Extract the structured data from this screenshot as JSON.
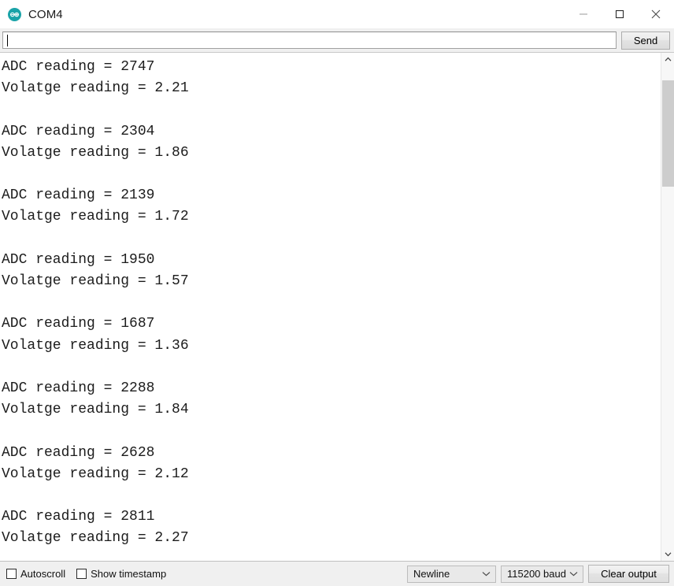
{
  "window": {
    "title": "COM4",
    "app_icon": "arduino-logo-icon",
    "accent_color": "#1aa3a8",
    "controls": {
      "minimize": "minimize-icon",
      "maximize": "maximize-icon",
      "close": "close-icon"
    }
  },
  "send_row": {
    "input_value": "",
    "input_placeholder": "",
    "send_label": "Send"
  },
  "output": {
    "text": "ADC reading = 2747\nVolatge reading = 2.21\n\nADC reading = 2304\nVolatge reading = 1.86\n\nADC reading = 2139\nVolatge reading = 1.72\n\nADC reading = 1950\nVolatge reading = 1.57\n\nADC reading = 1687\nVolatge reading = 1.36\n\nADC reading = 2288\nVolatge reading = 1.84\n\nADC reading = 2628\nVolatge reading = 2.12\n\nADC reading = 2811\nVolatge reading = 2.27",
    "readings": [
      {
        "adc_label": "ADC reading = 2747",
        "voltage_label": "Volatge reading = 2.21",
        "adc": 2747,
        "voltage": 2.21
      },
      {
        "adc_label": "ADC reading = 2304",
        "voltage_label": "Volatge reading = 1.86",
        "adc": 2304,
        "voltage": 1.86
      },
      {
        "adc_label": "ADC reading = 2139",
        "voltage_label": "Volatge reading = 1.72",
        "adc": 2139,
        "voltage": 1.72
      },
      {
        "adc_label": "ADC reading = 1950",
        "voltage_label": "Volatge reading = 1.57",
        "adc": 1950,
        "voltage": 1.57
      },
      {
        "adc_label": "ADC reading = 1687",
        "voltage_label": "Volatge reading = 1.36",
        "adc": 1687,
        "voltage": 1.36
      },
      {
        "adc_label": "ADC reading = 2288",
        "voltage_label": "Volatge reading = 1.84",
        "adc": 2288,
        "voltage": 1.84
      },
      {
        "adc_label": "ADC reading = 2628",
        "voltage_label": "Volatge reading = 2.12",
        "adc": 2628,
        "voltage": 2.12
      },
      {
        "adc_label": "ADC reading = 2811",
        "voltage_label": "Volatge reading = 2.27",
        "adc": 2811,
        "voltage": 2.27
      }
    ]
  },
  "scrollbar": {
    "up_icon": "chevron-up-icon",
    "down_icon": "chevron-down-icon"
  },
  "bottom_bar": {
    "autoscroll_label": "Autoscroll",
    "autoscroll_checked": false,
    "timestamp_label": "Show timestamp",
    "timestamp_checked": false,
    "line_ending_value": "Newline",
    "baud_value": "115200 baud",
    "clear_label": "Clear output"
  }
}
